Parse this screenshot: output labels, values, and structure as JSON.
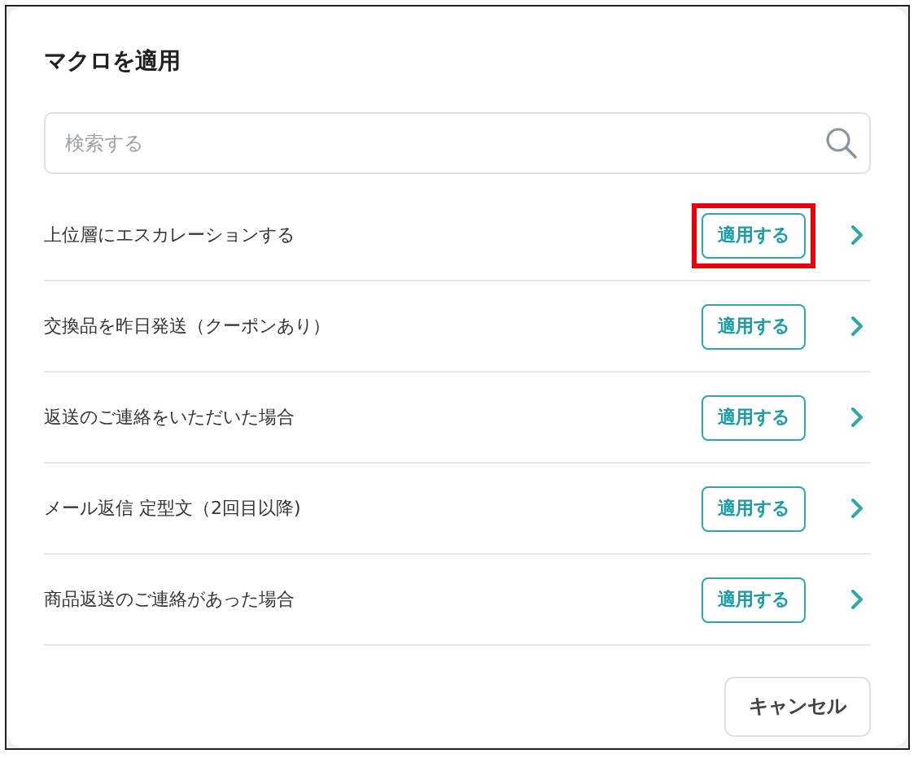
{
  "dialog": {
    "title": "マクロを適用"
  },
  "search": {
    "placeholder": "検索する"
  },
  "macros": [
    {
      "name": "上位層にエスカレーションする",
      "button": "適用する",
      "highlighted": true
    },
    {
      "name": "交換品を昨日発送（クーポンあり）",
      "button": "適用する",
      "highlighted": false
    },
    {
      "name": "返送のご連絡をいただいた場合",
      "button": "適用する",
      "highlighted": false
    },
    {
      "name": "メール返信 定型文（2回目以降)",
      "button": "適用する",
      "highlighted": false
    },
    {
      "name": "商品返送のご連絡があった場合",
      "button": "適用する",
      "highlighted": false
    }
  ],
  "buttons": [
    "キャンセル"
  ]
}
